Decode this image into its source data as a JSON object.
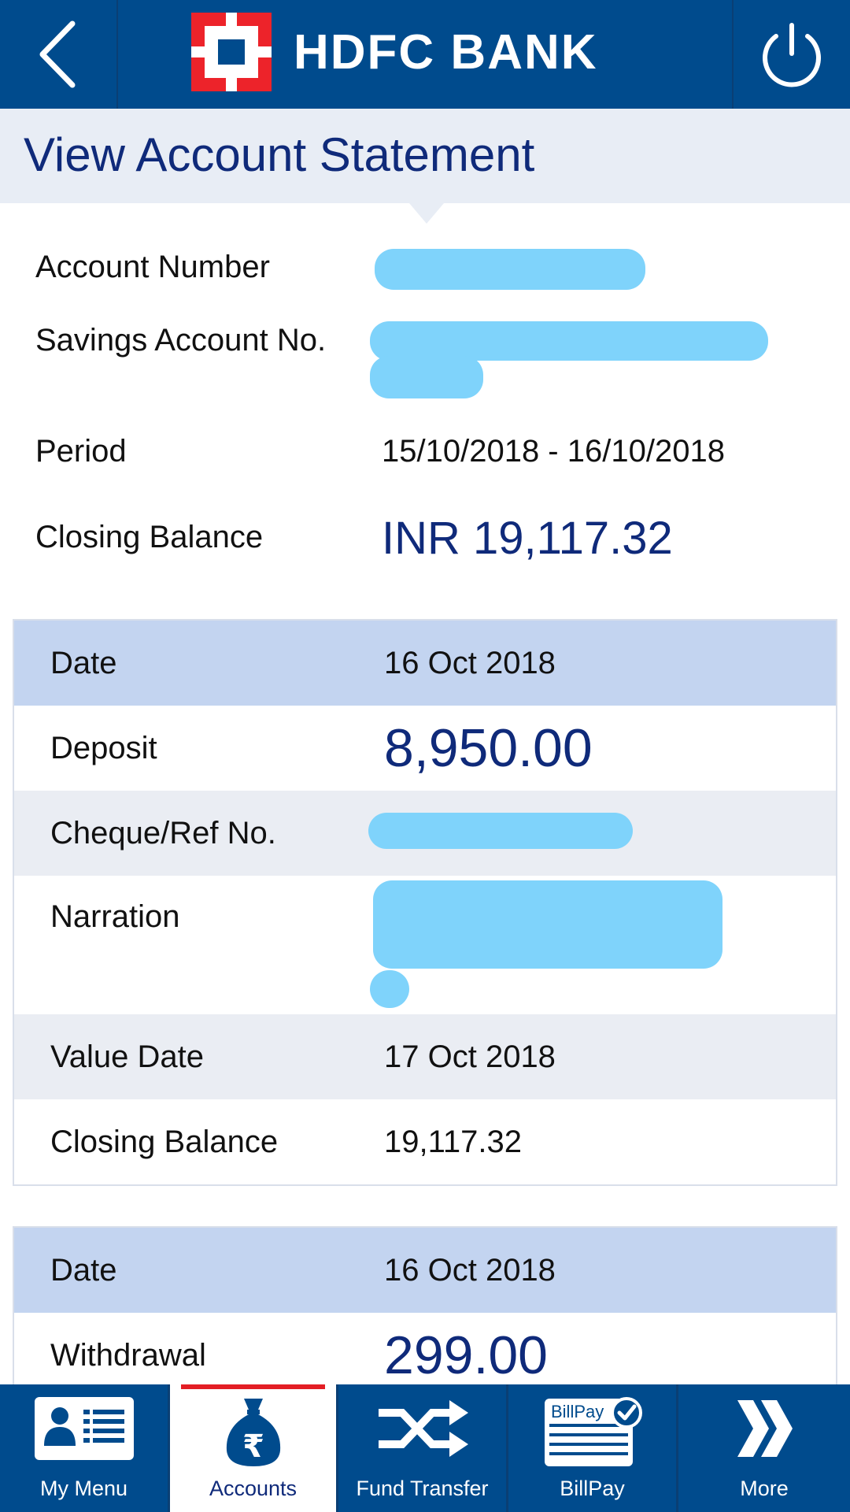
{
  "header": {
    "bank_name": "HDFC BANK",
    "back_icon": "chevron-left-icon",
    "power_icon": "power-icon",
    "bg_color": "#004b8d",
    "logo_color": "#ed232a"
  },
  "page": {
    "title": "View Account Statement"
  },
  "summary": {
    "account_number_label": "Account Number",
    "account_type_label": "Savings Account No.",
    "period_label": "Period",
    "period_value": "15/10/2018 - 16/10/2018",
    "closing_balance_label": "Closing Balance",
    "closing_balance_value": "INR 19,117.32"
  },
  "transactions": [
    {
      "date_label": "Date",
      "date": "16 Oct 2018",
      "type_label": "Deposit",
      "amount": "8,950.00",
      "cheque_label": "Cheque/Ref No.",
      "narration_label": "Narration",
      "value_date_label": "Value Date",
      "value_date": "17 Oct 2018",
      "closing_balance_label": "Closing Balance",
      "closing_balance": "19,117.32"
    },
    {
      "date_label": "Date",
      "date": "16 Oct 2018",
      "type_label": "Withdrawal",
      "amount": "299.00"
    }
  ],
  "bottom_nav": [
    {
      "label": "My Menu",
      "icon": "contact-card-icon"
    },
    {
      "label": "Accounts",
      "icon": "rupee-money-bag-icon",
      "active": true
    },
    {
      "label": "Fund Transfer",
      "icon": "shuffle-arrows-icon"
    },
    {
      "label": "BillPay",
      "icon": "billpay-icon",
      "icon_text": "BillPay"
    },
    {
      "label": "More",
      "icon": "double-chevron-right-icon"
    }
  ],
  "colors": {
    "accent": "#0f2a7a",
    "redaction": "#7fd3fb",
    "active_indicator": "#e31e24"
  }
}
